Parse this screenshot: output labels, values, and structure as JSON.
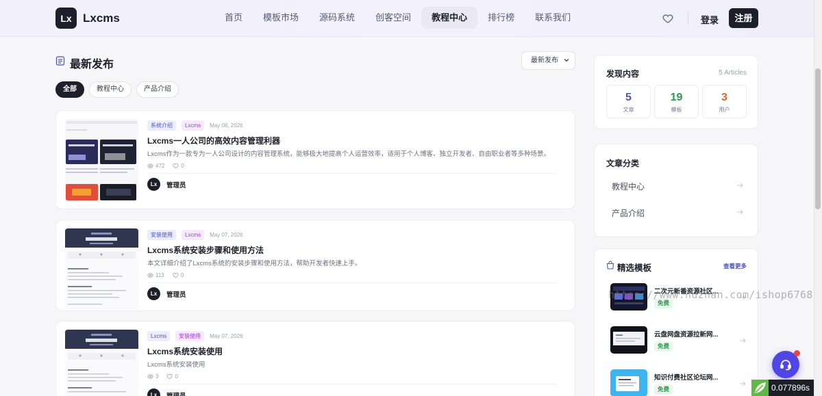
{
  "header": {
    "logo_mark": "Lx",
    "logo_text": "Lxcms",
    "nav": [
      "首页",
      "模板市场",
      "源码系统",
      "创客空间",
      "教程中心",
      "排行榜",
      "联系我们"
    ],
    "nav_active": 4,
    "login": "登录",
    "register": "注册"
  },
  "main": {
    "title": "最新发布",
    "sort": "最新发布",
    "filters": [
      "全部",
      "教程中心",
      "产品介绍"
    ],
    "articles": [
      {
        "tags": [
          {
            "label": "系统介绍",
            "color": "blue"
          },
          {
            "label": "Lxcms",
            "color": "purple"
          }
        ],
        "date": "May 08, 2026",
        "title": "Lxcms一人公司的高效内容管理利器",
        "desc": "Lxcms作为一款专为一人公司设计的内容管理系统，能够极大地提高个人运营效率，适用于个人博客、独立开发者、自由职业者等多种场景。",
        "views": "472",
        "likes": "0",
        "author_mark": "Lx",
        "author": "管理员"
      },
      {
        "tags": [
          {
            "label": "安装使用",
            "color": "blue"
          },
          {
            "label": "Lxcms",
            "color": "purple"
          }
        ],
        "date": "May 07, 2026",
        "title": "Lxcms系统安装步骤和使用方法",
        "desc": "本文详细介绍了Lxcms系统的安装步骤和使用方法，帮助开发者快速上手。",
        "views": "113",
        "likes": "0",
        "author_mark": "Lx",
        "author": "管理员"
      },
      {
        "tags": [
          {
            "label": "Lxcms",
            "color": "blue"
          },
          {
            "label": "安装使用",
            "color": "purple"
          }
        ],
        "date": "May 07, 2026",
        "title": "Lxcms系统安装使用",
        "desc": "Lxcms系统安装使用",
        "views": "3",
        "likes": "0",
        "author_mark": "Lx",
        "author": "管理员"
      }
    ]
  },
  "sidebar": {
    "discover": {
      "title": "发现内容",
      "count": "5 Articles",
      "stats": [
        {
          "num": "5",
          "label": "文章",
          "color": "#4a52c4"
        },
        {
          "num": "19",
          "label": "模板",
          "color": "#2a9a4b"
        },
        {
          "num": "3",
          "label": "用户",
          "color": "#e0652a"
        }
      ]
    },
    "categories": {
      "title": "文章分类",
      "items": [
        "教程中心",
        "产品介绍"
      ]
    },
    "featured": {
      "title": "精选模板",
      "more": "查看更多",
      "items": [
        {
          "name": "二次元新番资源社区...",
          "badge": "免费"
        },
        {
          "name": "云盘网盘资源拉新网...",
          "badge": "免费"
        },
        {
          "name": "知识付费社区论坛网...",
          "badge": "免费"
        }
      ]
    }
  },
  "overlay": {
    "watermark": "https://www.huzhan.com/ishop6768",
    "timer": "0.077896s"
  }
}
